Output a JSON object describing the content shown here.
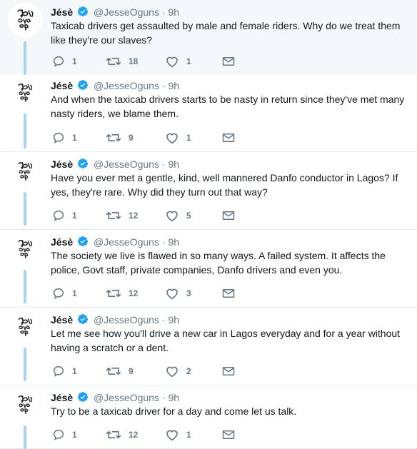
{
  "author": {
    "name": "Jésè",
    "handle": "@JesseOguns",
    "separator": "·"
  },
  "colors": {
    "verified": "#1da1f2",
    "thread_line": "#a8d4f4",
    "muted": "#657786"
  },
  "icons": {
    "reply": "reply-icon",
    "retweet": "retweet-icon",
    "like": "heart-icon",
    "dm": "mail-icon",
    "verified": "verified-badge-icon"
  },
  "tweets": [
    {
      "time": "9h",
      "text": "Taxicab drivers get assaulted by male and female riders. Why do we treat them like they're our slaves?",
      "replies": "1",
      "retweets": "18",
      "likes": "1"
    },
    {
      "time": "9h",
      "text": "And when the taxicab drivers starts to be nasty in return since they've met many nasty riders, we blame them.",
      "replies": "1",
      "retweets": "9",
      "likes": "1"
    },
    {
      "time": "9h",
      "text": "Have you ever met a gentle, kind, well mannered Danfo conductor in Lagos? If yes, they're rare. Why did they turn out that way?",
      "replies": "1",
      "retweets": "12",
      "likes": "5"
    },
    {
      "time": "9h",
      "text": "The society we live is flawed in so many ways. A failed system. It affects the police, Govt staff, private companies, Danfo drivers and even you.",
      "replies": "1",
      "retweets": "12",
      "likes": "3"
    },
    {
      "time": "9h",
      "text": "Let me see how you'll drive a new car in Lagos everyday and for a year without having a scratch or a dent.",
      "replies": "1",
      "retweets": "9",
      "likes": "2"
    },
    {
      "time": "9h",
      "text": "Try to be a taxicab driver for a day and come let us talk.",
      "replies": "1",
      "retweets": "12",
      "likes": "1"
    }
  ]
}
